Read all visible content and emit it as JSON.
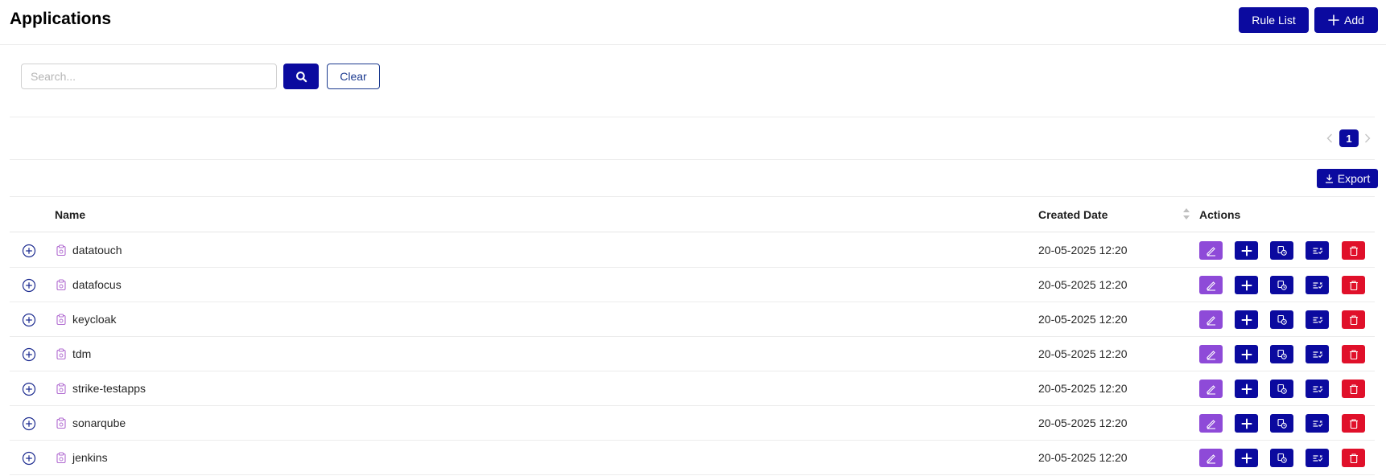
{
  "header": {
    "title": "Applications",
    "rule_list_label": "Rule List",
    "add_label": "Add"
  },
  "search": {
    "placeholder": "Search...",
    "value": "",
    "clear_label": "Clear"
  },
  "pagination": {
    "current_page": "1",
    "prev_icon": "chevron-left-icon",
    "next_icon": "chevron-right-icon"
  },
  "toolbar": {
    "export_label": "Export"
  },
  "table": {
    "columns": {
      "name": "Name",
      "created_date": "Created Date",
      "actions": "Actions"
    },
    "rows": [
      {
        "name": "datatouch",
        "created_date": "20-05-2025 12:20"
      },
      {
        "name": "datafocus",
        "created_date": "20-05-2025 12:20"
      },
      {
        "name": "keycloak",
        "created_date": "20-05-2025 12:20"
      },
      {
        "name": "tdm",
        "created_date": "20-05-2025 12:20"
      },
      {
        "name": "strike-testapps",
        "created_date": "20-05-2025 12:20"
      },
      {
        "name": "sonarqube",
        "created_date": "20-05-2025 12:20"
      },
      {
        "name": "jenkins",
        "created_date": "20-05-2025 12:20"
      }
    ],
    "row_actions": [
      "edit-icon",
      "plus-icon",
      "copy-icon",
      "rules-icon",
      "trash-icon"
    ]
  },
  "colors": {
    "primary": "#0b0a9f",
    "edit": "#8e4ad8",
    "delete": "#e0102a",
    "app_icon": "#b06ad0"
  }
}
